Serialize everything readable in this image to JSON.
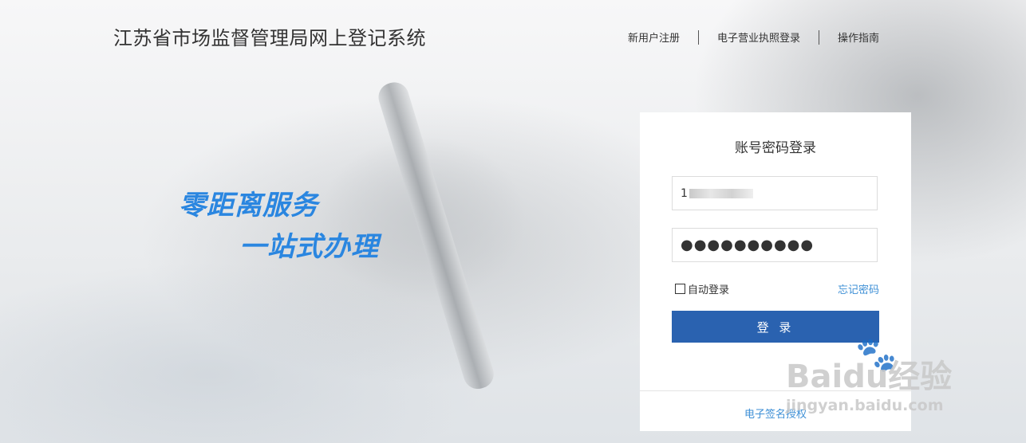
{
  "header": {
    "title": "江苏省市场监督管理局网上登记系统",
    "nav": [
      "新用户注册",
      "电子营业执照登录",
      "操作指南"
    ]
  },
  "slogan": {
    "line1": "零距离服务",
    "line2": "一站式办理"
  },
  "login": {
    "title": "账号密码登录",
    "username_value": "1",
    "password_value": "●●●●●●●●●●",
    "remember_label": "自动登录",
    "forgot_label": "忘记密码",
    "submit_label": "登 录",
    "esign_label": "电子签名授权"
  },
  "watermark": {
    "brand": "Baidu经验",
    "url": "jingyan.baidu.com"
  },
  "colors": {
    "accent": "#2a62b0",
    "link": "#3d8fd6",
    "slogan": "#2a86e0"
  },
  "icons": {
    "paw": "baidu-paw-icon",
    "checkbox": "checkbox-icon"
  }
}
